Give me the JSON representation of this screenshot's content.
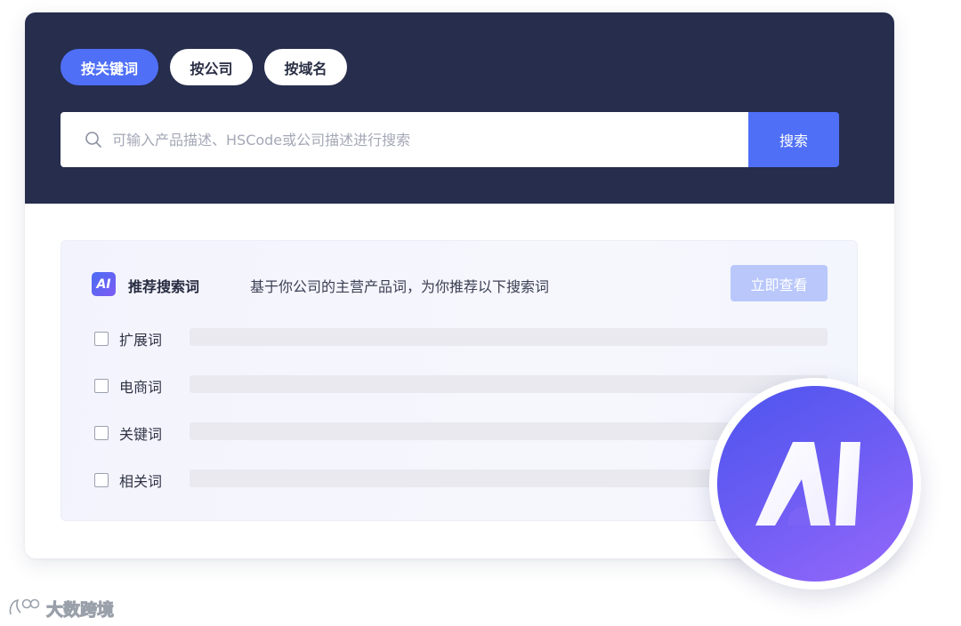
{
  "tabs": [
    {
      "label": "按关键词",
      "active": true
    },
    {
      "label": "按公司",
      "active": false
    },
    {
      "label": "按域名",
      "active": false
    }
  ],
  "search": {
    "placeholder": "可输入产品描述、HSCode或公司描述进行搜索",
    "value": "",
    "button_label": "搜索",
    "icon": "search-icon"
  },
  "panel": {
    "badge": "AI",
    "title": "推荐搜索词",
    "description": "基于你公司的主营产品词，为你推荐以下搜索词",
    "view_button": "立即查看",
    "rows": [
      {
        "label": "扩展词",
        "checked": false
      },
      {
        "label": "电商词",
        "checked": false
      },
      {
        "label": "关键词",
        "checked": false
      },
      {
        "label": "相关词",
        "checked": false
      }
    ]
  },
  "ai_logo": "AI",
  "watermark": "大数跨境",
  "colors": {
    "header_bg": "#262d4d",
    "accent": "#4f6ff7",
    "view_button_disabled": "#b9c7fb",
    "ai_gradient_start": "#4c55ee",
    "ai_gradient_end": "#9768fb"
  }
}
